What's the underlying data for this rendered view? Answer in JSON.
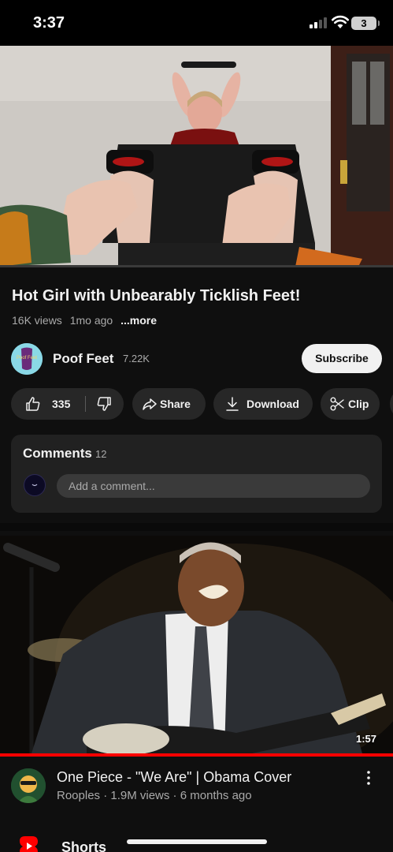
{
  "status_bar": {
    "time": "3:37",
    "battery": "3"
  },
  "player": {
    "progress_fraction": 0.0
  },
  "video": {
    "title": "Hot Girl with Unbearably Ticklish Feet!",
    "views": "16K views",
    "age": "1mo ago",
    "more_label": "...more"
  },
  "channel": {
    "name": "Poof Feet",
    "subscribers": "7.22K",
    "avatar_text": "Poof Feet"
  },
  "subscribe_label": "Subscribe",
  "actions": {
    "like_count": "335",
    "share_label": "Share",
    "download_label": "Download",
    "clip_label": "Clip"
  },
  "comments": {
    "title": "Comments",
    "count": "12",
    "placeholder": "Add a comment..."
  },
  "next_video": {
    "duration": "1:57",
    "title": "One Piece - \"We Are\" | Obama Cover",
    "meta": "Rooples · 1.9M views · 6 months ago"
  },
  "shorts": {
    "label": "Shorts"
  },
  "colors": {
    "accent": "#ff0000",
    "background": "#0f0f0f",
    "pill": "#272727",
    "card": "#212121"
  },
  "icons": [
    "thumbs-up-icon",
    "thumbs-down-icon",
    "share-icon",
    "download-icon",
    "scissors-icon",
    "kebab-menu-icon",
    "shorts-icon"
  ]
}
